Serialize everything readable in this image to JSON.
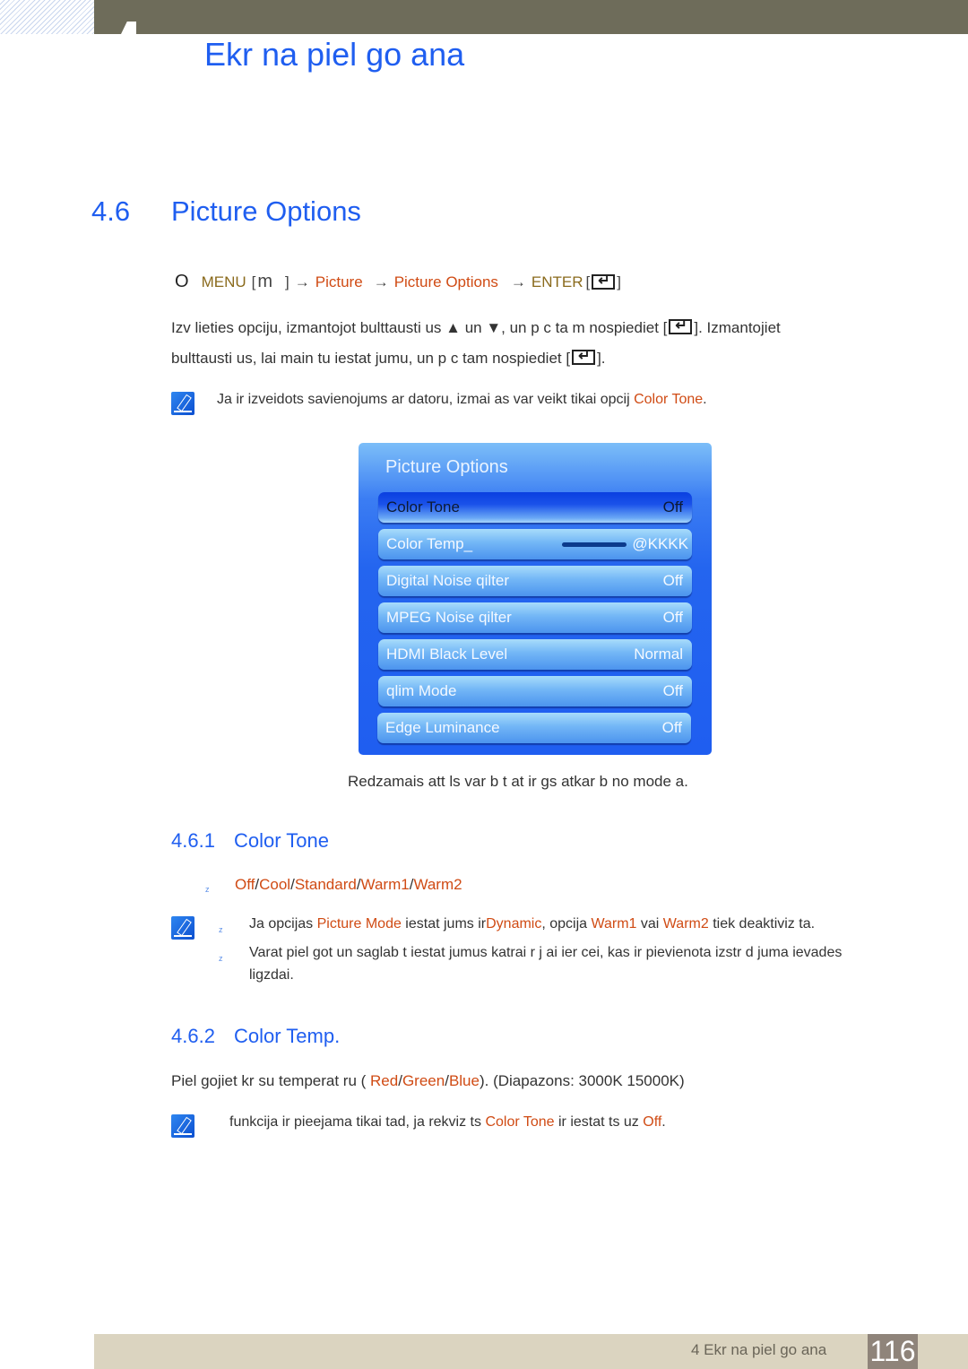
{
  "header": {
    "chapter_title": "Ekr na piel go ana"
  },
  "section": {
    "number": "4.6",
    "title": "Picture Options"
  },
  "menu_path": {
    "bullet": "O",
    "menu": "MENU",
    "menu_key": "m",
    "arrow": "→",
    "picture": "Picture",
    "picture_options": "Picture Options",
    "enter": "ENTER",
    "open_bracket": "[",
    "close_bracket": "]"
  },
  "instructions": {
    "line1_a": "Izv lieties opciju, izmantojot bulttausti us  ▲ un  ▼, un p c ta m nospiediet [",
    "line1_b": "]. Izmantojiet",
    "line2_a": "bulttausti us, lai main tu iestat jumu, un p c tam nospiediet [",
    "line2_b": "]."
  },
  "note1": {
    "text": "Ja ir izveidots savienojums ar datoru, izmai as var veikt tikai opcij ",
    "highlight": "Color Tone",
    "end": "."
  },
  "tv_menu": {
    "title": "Picture Options",
    "items": [
      {
        "label": "Color Tone",
        "value": "Off",
        "selected": true
      },
      {
        "label": "Color Temp_",
        "value": "@KKKK",
        "has_slider": true
      },
      {
        "label": "Digital Noise qilter",
        "value": "Off"
      },
      {
        "label": "MPEG Noise qilter",
        "value": "Off"
      },
      {
        "label": "HDMI Black Level",
        "value": "Normal"
      },
      {
        "label": "qlim Mode",
        "value": "Off"
      },
      {
        "label": "Edge Luminance",
        "value": "Off"
      }
    ]
  },
  "caption": "Redzamais att ls var b t at  ir gs atkar b  no mode a.",
  "sub1": {
    "number": "4.6.1",
    "title": "Color Tone",
    "bullet": "z",
    "options": [
      "Off",
      "Cool",
      "Standard",
      "Warm1",
      "Warm2"
    ],
    "separator": "/",
    "note_bullet1": {
      "a": "Ja opcijas ",
      "picture_mode": "Picture Mode",
      "b": "  iestat jums ir",
      "dynamic": "Dynamic",
      "c": ", opcija ",
      "warm1": "Warm1",
      "d": "  vai ",
      "warm2": "Warm2",
      "e": "  tiek deaktiviz ta."
    },
    "note_bullet2_line1": "Varat piel got un saglab t iestat jumus katrai  r j ai ier cei, kas ir pievienota izstr d juma ievades",
    "note_bullet2_line2": "ligzdai."
  },
  "sub2": {
    "number": "4.6.2",
    "title": "Color Temp.",
    "para_a": "Piel gojiet kr su temperat ru ( ",
    "red": "Red",
    "green": "Green",
    "blue": "Blue",
    "para_b": "). (Diapazons: 3000K 15000K)",
    "note_a": "funkcija ir pieejama tikai tad, ja rekviz ts ",
    "note_color_tone": "Color Tone",
    "note_b": "  ir iestat ts uz ",
    "note_off": "Off",
    "note_end": "."
  },
  "footer": {
    "chapter": "4 Ekr na piel go ana",
    "page": "116"
  }
}
